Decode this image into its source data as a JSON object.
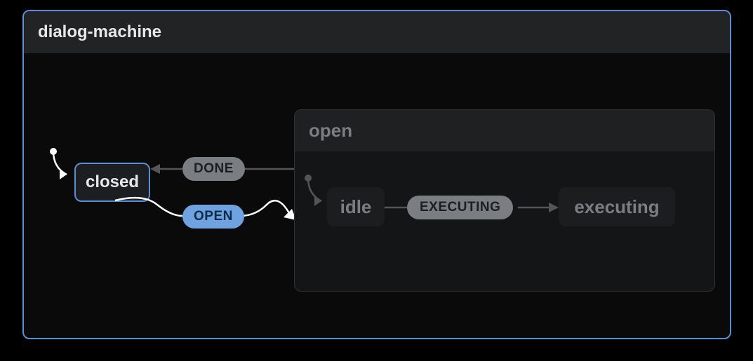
{
  "machine": {
    "title": "dialog-machine",
    "states": {
      "closed": {
        "label": "closed"
      },
      "open": {
        "label": "open",
        "children": {
          "idle": {
            "label": "idle"
          },
          "executing": {
            "label": "executing"
          }
        }
      }
    },
    "events": {
      "done": {
        "label": "DONE"
      },
      "open": {
        "label": "OPEN"
      },
      "executing": {
        "label": "EXECUTING"
      }
    }
  },
  "chart_data": {
    "type": "state-machine",
    "name": "dialog-machine",
    "initial": "closed",
    "states": [
      {
        "id": "closed",
        "active": true
      },
      {
        "id": "open",
        "initial": "idle",
        "children": [
          {
            "id": "idle"
          },
          {
            "id": "executing"
          }
        ]
      }
    ],
    "transitions": [
      {
        "from": "closed",
        "to": "open",
        "event": "OPEN",
        "active": true
      },
      {
        "from": "open",
        "to": "closed",
        "event": "DONE"
      },
      {
        "from": "open.idle",
        "to": "open.executing",
        "event": "EXECUTING"
      }
    ]
  }
}
